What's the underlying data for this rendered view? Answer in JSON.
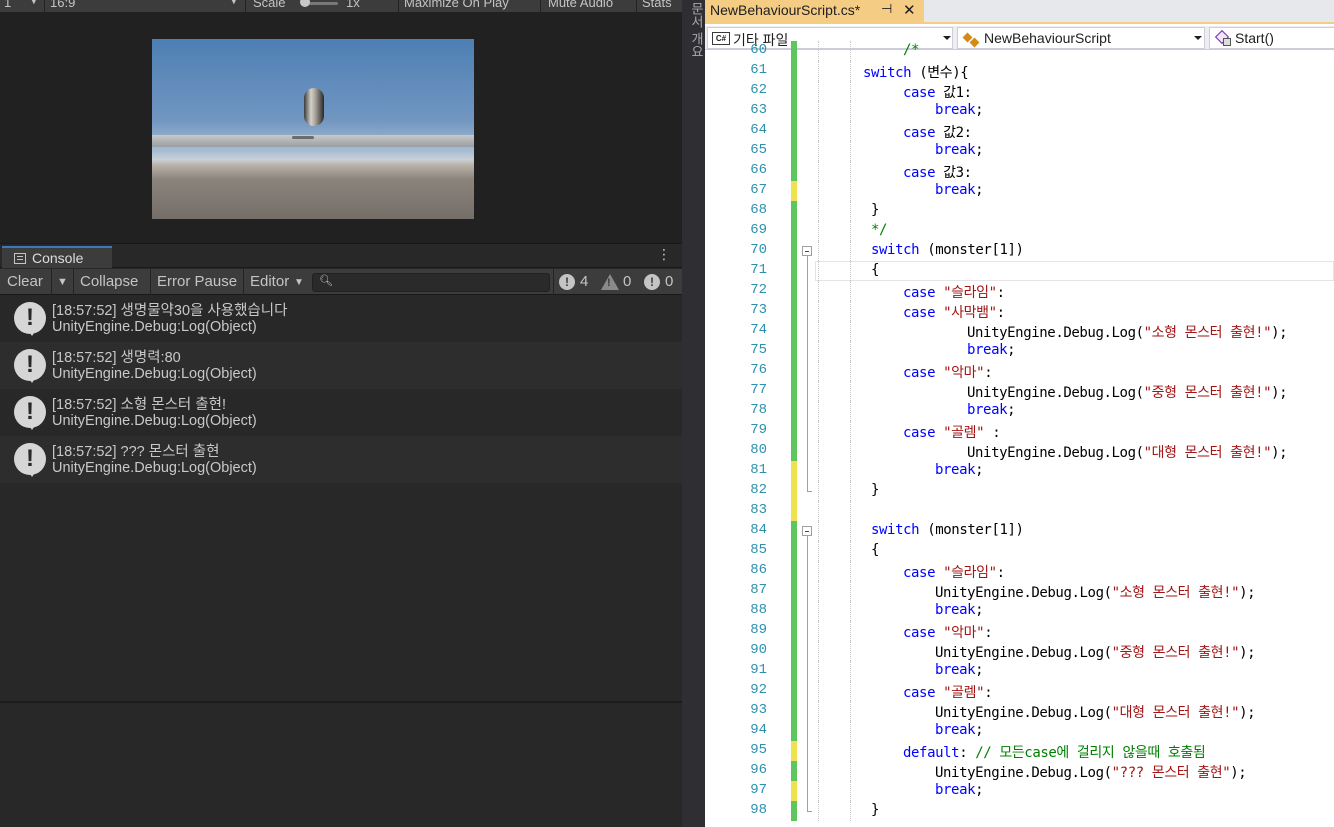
{
  "game_toolbar": {
    "display": "1",
    "aspect": "16:9",
    "scale_label": "Scale",
    "scale_value": "1x",
    "maximize": "Maximize On Play",
    "mute": "Mute Audio",
    "stats": "Stats"
  },
  "console": {
    "tab_label": "Console",
    "clear": "Clear",
    "collapse": "Collapse",
    "error_pause": "Error Pause",
    "editor": "Editor",
    "info_count": "4",
    "warn_count": "0",
    "error_count": "0",
    "logs": [
      {
        "message": "[18:57:52] 생명물약30을 사용했습니다",
        "source": "UnityEngine.Debug:Log(Object)"
      },
      {
        "message": "[18:57:52] 생명력:80",
        "source": "UnityEngine.Debug:Log(Object)"
      },
      {
        "message": "[18:57:52] 소형 몬스터 출현!",
        "source": "UnityEngine.Debug:Log(Object)"
      },
      {
        "message": "[18:57:52] ??? 몬스터 출현",
        "source": "UnityEngine.Debug:Log(Object)"
      }
    ]
  },
  "side_strip": {
    "label": "문서 개요"
  },
  "vs": {
    "tab_title": "NewBehaviourScript.cs*",
    "pin": "⊣",
    "close": "✕",
    "nav_project_icon": "C#",
    "nav_project": "기타 파일",
    "nav_class": "NewBehaviourScript",
    "nav_member": "Start()",
    "first_line_number": 60,
    "current_line": 71,
    "lines": [
      {
        "n": "60",
        "bar": "saved",
        "text": "    /*"
      },
      {
        "n": "61",
        "bar": "saved",
        "text": "switch (변수){"
      },
      {
        "n": "62",
        "bar": "saved",
        "text": "    case 값1:"
      },
      {
        "n": "63",
        "bar": "saved",
        "text": "        break;"
      },
      {
        "n": "64",
        "bar": "saved",
        "text": "    case 값2:"
      },
      {
        "n": "65",
        "bar": "saved",
        "text": "        break;"
      },
      {
        "n": "66",
        "bar": "saved",
        "text": "    case 값3:"
      },
      {
        "n": "67",
        "bar": "unsaved",
        "text": "        break;"
      },
      {
        "n": "68",
        "bar": "saved",
        "text": "}"
      },
      {
        "n": "69",
        "bar": "saved",
        "text": "*/"
      },
      {
        "n": "70",
        "bar": "saved",
        "text": "switch (monster[1])"
      },
      {
        "n": "71",
        "bar": "saved",
        "text": "{"
      },
      {
        "n": "72",
        "bar": "saved",
        "text": "    case \"슬라임\":"
      },
      {
        "n": "73",
        "bar": "saved",
        "text": "    case \"사막뱀\":"
      },
      {
        "n": "74",
        "bar": "saved",
        "text": "            UnityEngine.Debug.Log(\"소형 몬스터 출현!\");"
      },
      {
        "n": "75",
        "bar": "saved",
        "text": "            break;"
      },
      {
        "n": "76",
        "bar": "saved",
        "text": "    case \"악마\":"
      },
      {
        "n": "77",
        "bar": "saved",
        "text": "            UnityEngine.Debug.Log(\"중형 몬스터 출현!\");"
      },
      {
        "n": "78",
        "bar": "saved",
        "text": "            break;"
      },
      {
        "n": "79",
        "bar": "saved",
        "text": "    case \"골렘\" :"
      },
      {
        "n": "80",
        "bar": "saved",
        "text": "            UnityEngine.Debug.Log(\"대형 몬스터 출현!\");"
      },
      {
        "n": "81",
        "bar": "unsaved",
        "text": "        break;"
      },
      {
        "n": "82",
        "bar": "unsaved",
        "text": "}"
      },
      {
        "n": "83",
        "bar": "unsaved",
        "text": ""
      },
      {
        "n": "84",
        "bar": "saved",
        "text": "switch (monster[1])"
      },
      {
        "n": "85",
        "bar": "saved",
        "text": "{"
      },
      {
        "n": "86",
        "bar": "saved",
        "text": "    case \"슬라임\":"
      },
      {
        "n": "87",
        "bar": "saved",
        "text": "        UnityEngine.Debug.Log(\"소형 몬스터 출현!\");"
      },
      {
        "n": "88",
        "bar": "saved",
        "text": "        break;"
      },
      {
        "n": "89",
        "bar": "saved",
        "text": "    case \"악마\":"
      },
      {
        "n": "90",
        "bar": "saved",
        "text": "        UnityEngine.Debug.Log(\"중형 몬스터 출현!\");"
      },
      {
        "n": "91",
        "bar": "saved",
        "text": "        break;"
      },
      {
        "n": "92",
        "bar": "saved",
        "text": "    case \"골렘\":"
      },
      {
        "n": "93",
        "bar": "saved",
        "text": "        UnityEngine.Debug.Log(\"대형 몬스터 출현!\");"
      },
      {
        "n": "94",
        "bar": "saved",
        "text": "        break;"
      },
      {
        "n": "95",
        "bar": "unsaved",
        "text": "    default: // 모든case에 걸리지 않을때 호출됨"
      },
      {
        "n": "96",
        "bar": "saved",
        "text": "        UnityEngine.Debug.Log(\"??? 몬스터 출현\");"
      },
      {
        "n": "97",
        "bar": "unsaved",
        "text": "        break;"
      },
      {
        "n": "98",
        "bar": "saved",
        "text": "}"
      }
    ]
  },
  "colors": {
    "keyword": "#0000ff",
    "string": "#a31515",
    "comment": "#008000",
    "line_number": "#2b91af",
    "tab_active": "#f5cc84",
    "change_saved": "#5ec65e",
    "change_unsaved": "#efe24c"
  }
}
